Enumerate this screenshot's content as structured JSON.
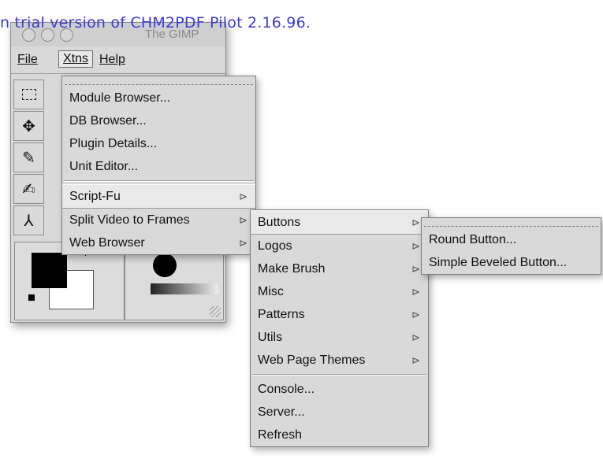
{
  "watermark": "n trial version of CHM2PDF Pilot 2.16.96.",
  "window": {
    "title": "The GIMP",
    "menubar": [
      "File",
      "Xtns",
      "Help"
    ]
  },
  "xtns_menu": {
    "items": [
      "Module Browser...",
      "DB Browser...",
      "Plugin Details...",
      "Unit Editor..."
    ],
    "submenus": [
      "Script-Fu",
      "Split Video to Frames",
      "Web Browser"
    ]
  },
  "scriptfu_menu": {
    "items": [
      "Buttons",
      "Logos",
      "Make Brush",
      "Misc",
      "Patterns",
      "Utils",
      "Web Page Themes"
    ],
    "commands": [
      "Console...",
      "Server...",
      "Refresh"
    ]
  },
  "buttons_menu": {
    "items": [
      "Round Button...",
      "Simple Beveled Button..."
    ]
  },
  "icons": {
    "rect_select": "rect-select-icon",
    "move": "move-icon",
    "color_picker": "color-picker-icon",
    "clone": "clone-icon",
    "measure": "measure-icon",
    "submenu_arrow": "submenu-arrow-icon"
  }
}
